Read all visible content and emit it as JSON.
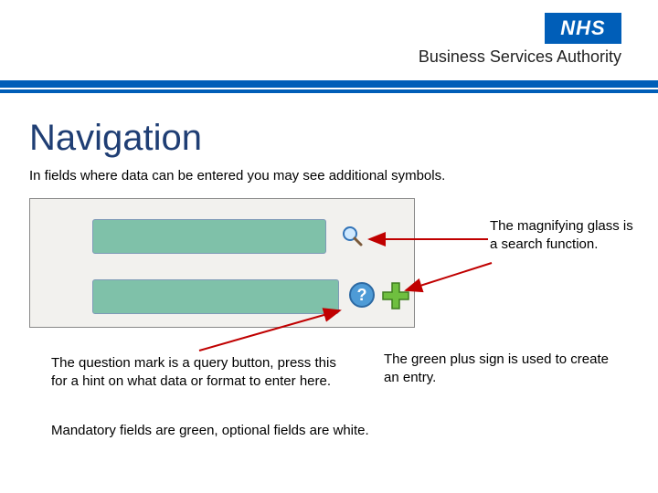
{
  "header": {
    "nhs_logo_text": "NHS",
    "org_name": "Business Services Authority"
  },
  "page": {
    "title": "Navigation",
    "intro": "In fields where data can be entered you may see additional symbols."
  },
  "captions": {
    "magnifier": "The magnifying glass is a search function.",
    "question": "The question mark is a query button, press this for a hint on what data or format to enter here.",
    "plus": "The green plus sign is used to create an entry.",
    "mandatory": "Mandatory fields are green,  optional fields are white."
  },
  "icons": {
    "search": "search-icon",
    "help": "help-icon",
    "plus": "plus-icon"
  }
}
